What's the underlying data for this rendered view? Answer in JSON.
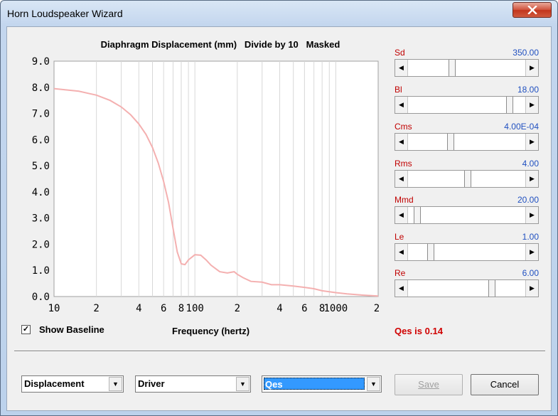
{
  "window": {
    "title": "Horn Loudspeaker Wizard"
  },
  "chart_data": {
    "type": "line",
    "title": "Diaphragm Displacement (mm)   Divide by 10   Masked",
    "xlabel": "Frequency (hertz)",
    "ylabel": "",
    "xscale": "log",
    "xlim": [
      10,
      2000
    ],
    "ylim": [
      0,
      9
    ],
    "grid": true,
    "yticks": [
      "0.0",
      "1.0",
      "2.0",
      "3.0",
      "4.0",
      "5.0",
      "6.0",
      "7.0",
      "8.0",
      "9.0"
    ],
    "xtick_labels": [
      "10",
      "2",
      "4",
      "6",
      "8",
      "100",
      "2",
      "4",
      "6",
      "8",
      "1000",
      "2"
    ],
    "line_color": "#f4b0b0",
    "series": [
      {
        "x": [
          10,
          15,
          20,
          25,
          30,
          35,
          40,
          45,
          50,
          55,
          60,
          65,
          70,
          75,
          80,
          85,
          90,
          100,
          110,
          120,
          130,
          150,
          170,
          190,
          200,
          220,
          250,
          300,
          350,
          400,
          500,
          600,
          700,
          800,
          1000,
          1200,
          1500,
          2000
        ],
        "y": [
          7.95,
          7.85,
          7.7,
          7.5,
          7.25,
          6.95,
          6.6,
          6.2,
          5.7,
          5.1,
          4.4,
          3.6,
          2.6,
          1.7,
          1.25,
          1.22,
          1.4,
          1.6,
          1.58,
          1.4,
          1.2,
          0.95,
          0.9,
          0.95,
          0.85,
          0.72,
          0.58,
          0.55,
          0.45,
          0.45,
          0.4,
          0.35,
          0.3,
          0.22,
          0.15,
          0.1,
          0.06,
          0.02
        ]
      }
    ]
  },
  "options": {
    "show_baseline_label": "Show Baseline",
    "show_baseline_checked": "✓"
  },
  "status": {
    "qes_text": "Qes is 0.14"
  },
  "params": [
    {
      "name": "Sd",
      "value": "350.00",
      "level": 0.36
    },
    {
      "name": "Bl",
      "value": "18.00",
      "level": 0.88
    },
    {
      "name": "Cms",
      "value": "4.00E-04",
      "level": 0.35
    },
    {
      "name": "Rms",
      "value": "4.00",
      "level": 0.5
    },
    {
      "name": "Mmd",
      "value": "20.00",
      "level": 0.05
    },
    {
      "name": "Le",
      "value": "1.00",
      "level": 0.17
    },
    {
      "name": "Re",
      "value": "6.00",
      "level": 0.72
    }
  ],
  "controls": {
    "combo1": "Displacement",
    "combo2": "Driver",
    "combo3": "Qes",
    "save_label": "Save",
    "cancel_label": "Cancel"
  },
  "icons": {
    "close": "close-icon",
    "dropdown": "chevron-down-icon",
    "scroll_left": "arrow-left-icon",
    "scroll_right": "arrow-right-icon"
  }
}
